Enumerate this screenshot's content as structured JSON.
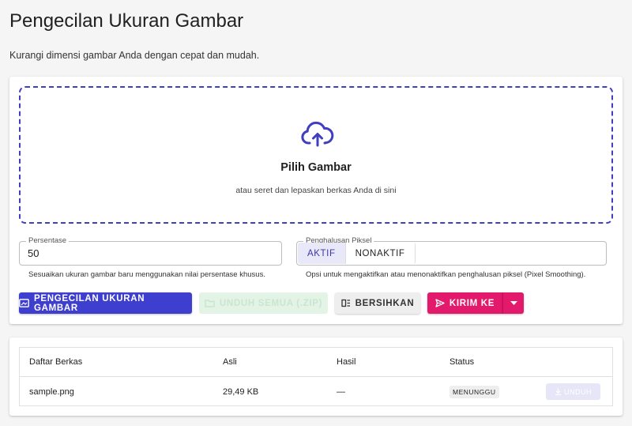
{
  "header": {
    "title": "Pengecilan Ukuran Gambar",
    "subtitle": "Kurangi dimensi gambar Anda dengan cepat dan mudah."
  },
  "dropzone": {
    "icon": "cloud-upload-icon",
    "title": "Pilih Gambar",
    "subtitle": "atau seret dan lepaskan berkas Anda di sini"
  },
  "percent_field": {
    "label": "Persentase",
    "value": "50",
    "hint": "Sesuaikan ukuran gambar baru menggunakan nilai persentase khusus."
  },
  "smoothing_field": {
    "label": "Penghalusan Piksel",
    "options": [
      "AKTIF",
      "NONAKTIF"
    ],
    "selected": "AKTIF",
    "hint": "Opsi untuk mengaktifkan atau menonaktifkan penghalusan piksel (Pixel Smoothing)."
  },
  "actions": {
    "resize_label": "PENGECILAN UKURAN GAMBAR",
    "download_all_label": "UNDUH SEMUA (.ZIP)",
    "clear_label": "BERSIHKAN",
    "send_label": "KIRIM KE"
  },
  "colors": {
    "primary": "#3f3fcf",
    "accent": "#e3196b",
    "dropzone_border": "#3f3fbf"
  },
  "file_table": {
    "columns": [
      "Daftar Berkas",
      "Asli",
      "Hasil",
      "Status"
    ],
    "rows": [
      {
        "name": "sample.png",
        "original": "29,49 KB",
        "result": "—",
        "status": "MENUNGGU",
        "action": "UNDUH"
      }
    ]
  }
}
